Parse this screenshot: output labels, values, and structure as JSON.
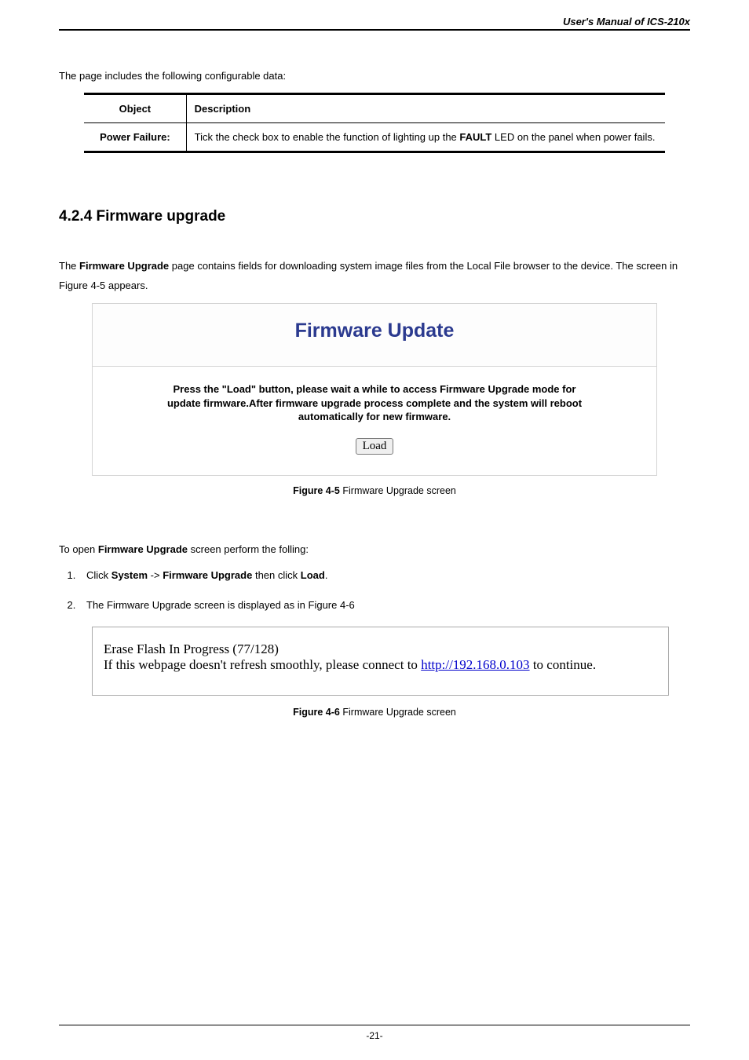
{
  "header": {
    "manual_title": "User's Manual of ICS-210x"
  },
  "intro": "The page includes the following configurable data:",
  "table": {
    "headers": {
      "col1": "Object",
      "col2": "Description"
    },
    "row": {
      "object": "Power Failure:",
      "desc_prefix": "Tick the check box to enable the function of lighting up the ",
      "desc_bold": "FAULT",
      "desc_suffix": " LED on the panel when power fails."
    }
  },
  "section": {
    "heading": "4.2.4 Firmware upgrade",
    "para_prefix": "The ",
    "para_bold1": "Firmware Upgrade",
    "para_suffix": " page contains fields for downloading system image files from the Local File browser  to the device. The screen in Figure 4-5 appears."
  },
  "fw_panel": {
    "title": "Firmware Update",
    "instructions": "Press the \"Load\" button, please wait a while to access Firmware Upgrade mode for update firmware.After firmware upgrade process complete and the system will reboot automatically for new firmware.",
    "load_label": "Load"
  },
  "caption1": {
    "bold": "Figure 4-5",
    "rest": " Firmware Upgrade screen"
  },
  "open_line": {
    "prefix": "To open ",
    "bold": "Firmware Upgrade",
    "suffix": " screen perform the folling:"
  },
  "steps": {
    "s1": {
      "p1": "Click ",
      "b1": "System",
      "p2": " -> ",
      "b2": "Firmware Upgrade",
      "p3": " then click ",
      "b3": "Load",
      "p4": "."
    },
    "s2": "The Firmware Upgrade screen is displayed as in Figure 4-6"
  },
  "flash_panel": {
    "line1": "Erase Flash In Progress (77/128)",
    "line2_prefix": "If this webpage doesn't refresh smoothly, please connect to ",
    "link": "http://192.168.0.103",
    "line2_suffix": " to continue."
  },
  "caption2": {
    "bold": "Figure 4-6",
    "rest": " Firmware Upgrade screen"
  },
  "footer": {
    "page_number": "-21-"
  }
}
